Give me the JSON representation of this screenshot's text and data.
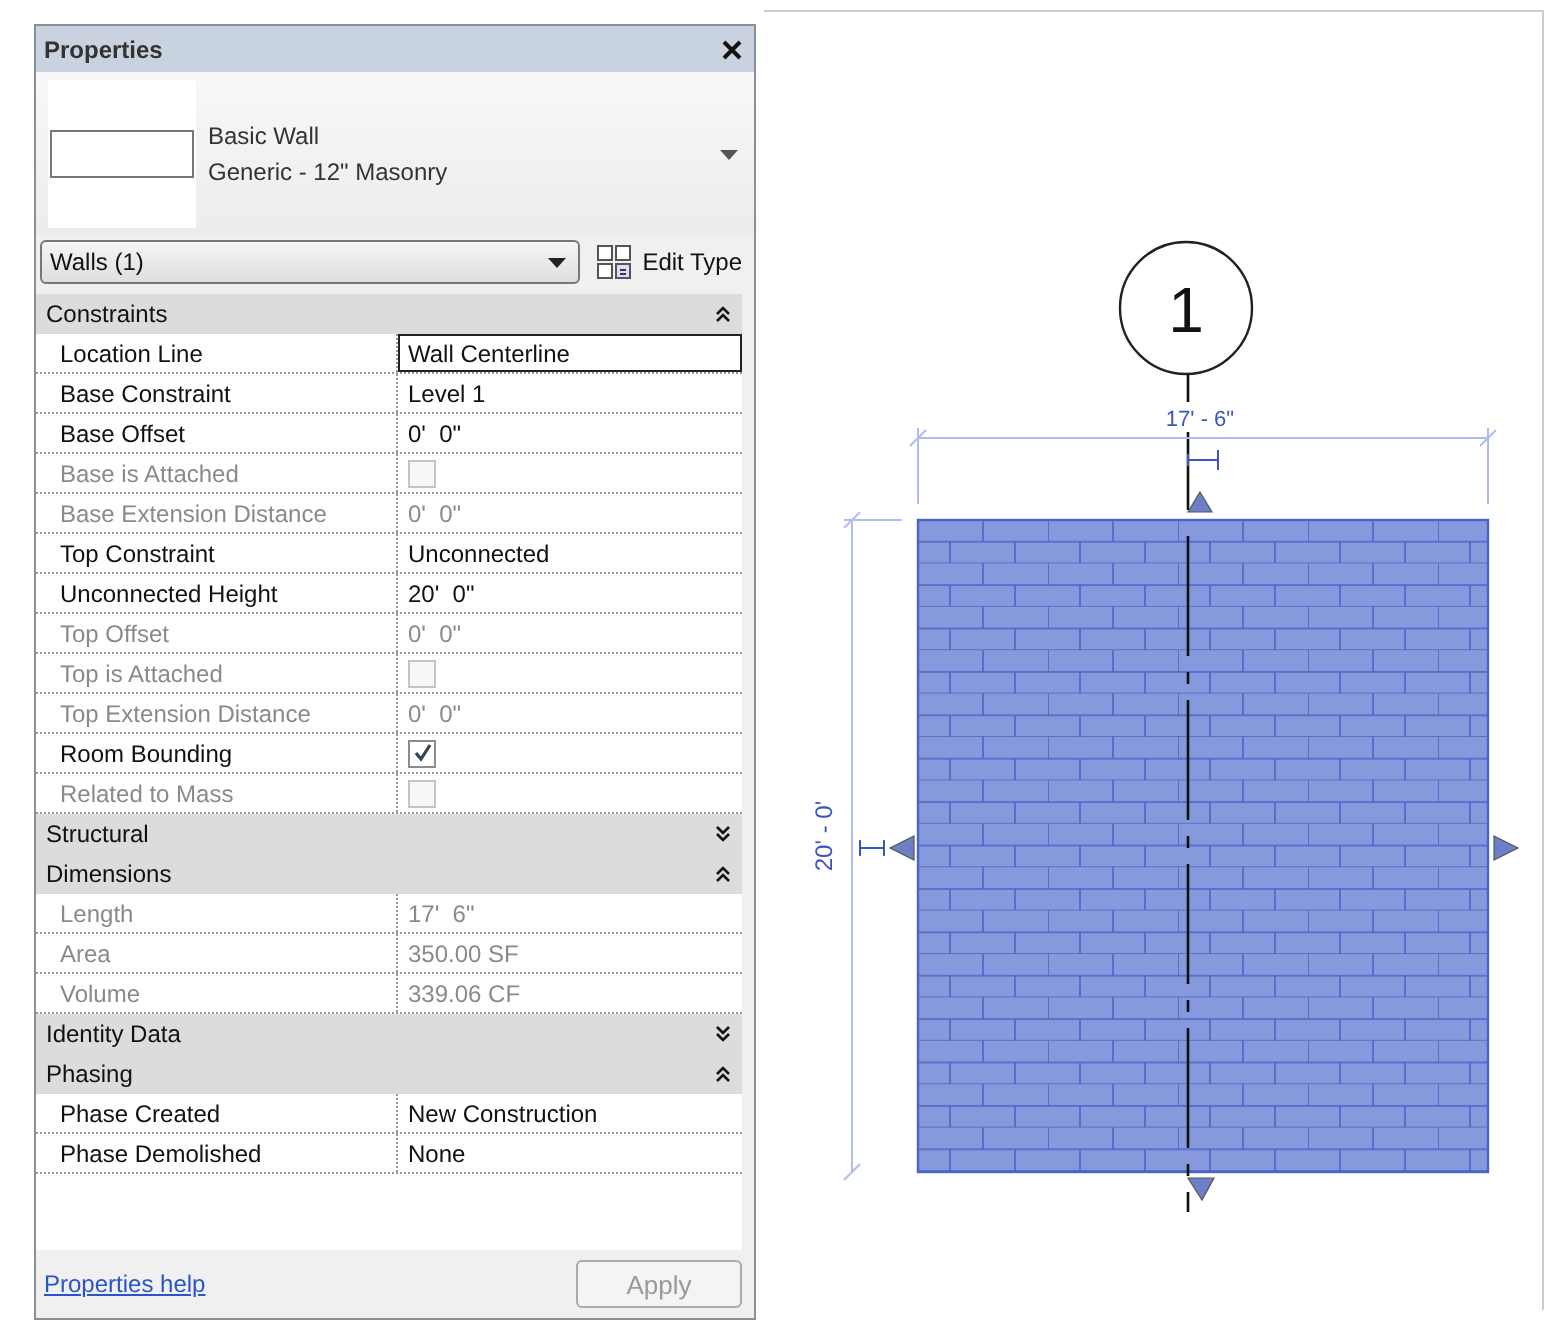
{
  "panel": {
    "title": "Properties",
    "type_family": "Basic Wall",
    "type_name": "Generic - 12\" Masonry",
    "filter": "Walls (1)",
    "edit_type": "Edit Type",
    "help_link": "Properties help",
    "apply": {
      "label": "Apply",
      "disabled": true
    }
  },
  "groups": [
    {
      "name": "Constraints",
      "expanded": true,
      "rows": [
        {
          "label": "Location Line",
          "kind": "text",
          "value": "Wall Centerline",
          "disabled": false,
          "selected": true
        },
        {
          "label": "Base Constraint",
          "kind": "text",
          "value": "Level 1",
          "disabled": false,
          "selected": false
        },
        {
          "label": "Base Offset",
          "kind": "text",
          "value": "0'  0\"",
          "disabled": false,
          "selected": false
        },
        {
          "label": "Base is Attached",
          "kind": "checkbox",
          "checked": false,
          "disabled": true,
          "selected": false
        },
        {
          "label": "Base Extension Distance",
          "kind": "text",
          "value": "0'  0\"",
          "disabled": true,
          "selected": false
        },
        {
          "label": "Top Constraint",
          "kind": "text",
          "value": "Unconnected",
          "disabled": false,
          "selected": false
        },
        {
          "label": "Unconnected Height",
          "kind": "text",
          "value": "20'  0\"",
          "disabled": false,
          "selected": false
        },
        {
          "label": "Top Offset",
          "kind": "text",
          "value": "0'  0\"",
          "disabled": true,
          "selected": false
        },
        {
          "label": "Top is Attached",
          "kind": "checkbox",
          "checked": false,
          "disabled": true,
          "selected": false
        },
        {
          "label": "Top Extension Distance",
          "kind": "text",
          "value": "0'  0\"",
          "disabled": true,
          "selected": false
        },
        {
          "label": "Room Bounding",
          "kind": "checkbox",
          "checked": true,
          "disabled": false,
          "selected": false
        },
        {
          "label": "Related to Mass",
          "kind": "checkbox",
          "checked": false,
          "disabled": true,
          "selected": false
        }
      ]
    },
    {
      "name": "Structural",
      "expanded": false
    },
    {
      "name": "Dimensions",
      "expanded": true,
      "rows": [
        {
          "label": "Length",
          "kind": "text",
          "value": "17'  6\"",
          "disabled": true,
          "selected": false
        },
        {
          "label": "Area",
          "kind": "text",
          "value": "350.00 SF",
          "disabled": true,
          "selected": false
        },
        {
          "label": "Volume",
          "kind": "text",
          "value": "339.06 CF",
          "disabled": true,
          "selected": false
        }
      ]
    },
    {
      "name": "Identity Data",
      "expanded": false
    },
    {
      "name": "Phasing",
      "expanded": true,
      "rows": [
        {
          "label": "Phase Created",
          "kind": "text",
          "value": "New Construction",
          "disabled": false,
          "selected": false
        },
        {
          "label": "Phase Demolished",
          "kind": "text",
          "value": "None",
          "disabled": false,
          "selected": false
        }
      ]
    }
  ],
  "drawing": {
    "grid_label": "1",
    "width_dim": "17' - 6\"",
    "height_dim": "20' - 0'"
  }
}
